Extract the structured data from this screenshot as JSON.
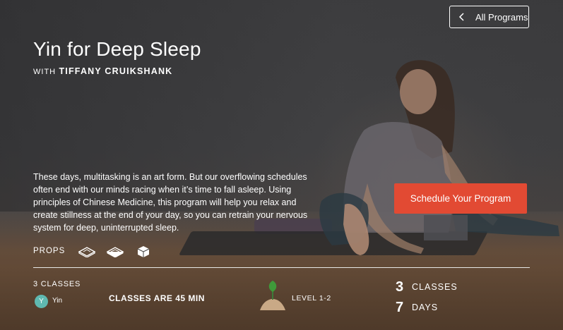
{
  "nav": {
    "back_label": "All Programs",
    "back_icon": "chevron-left-icon"
  },
  "program": {
    "title": "Yin for Deep Sleep",
    "with_label": "WITH",
    "instructor": "TIFFANY CRUIKSHANK",
    "description": "These days, multitasking is an art form. But our overflowing schedules often end with our minds racing when it’s time to fall asleep. Using principles of Chinese Medicine, this program will help you relax and create stillness at the end of your day, so you can retrain your nervous system for deep, uninterrupted sleep."
  },
  "cta": {
    "schedule_label": "Schedule Your Program",
    "color": "#e24a33"
  },
  "props": {
    "label": "PROPS",
    "items": [
      {
        "icon": "bolster-icon"
      },
      {
        "icon": "blanket-icon"
      },
      {
        "icon": "block-icon"
      }
    ]
  },
  "details": {
    "classes_count": "3 CLASSES",
    "style_initial": "Y",
    "style_name": "Yin",
    "style_color": "#5fb9b1",
    "duration": "CLASSES ARE 45 MIN",
    "level_icon": "sprout-icon",
    "level": "LEVEL 1-2"
  },
  "stats": {
    "classes_num": "3",
    "classes_label": "CLASSES",
    "days_num": "7",
    "days_label": "DAYS"
  }
}
